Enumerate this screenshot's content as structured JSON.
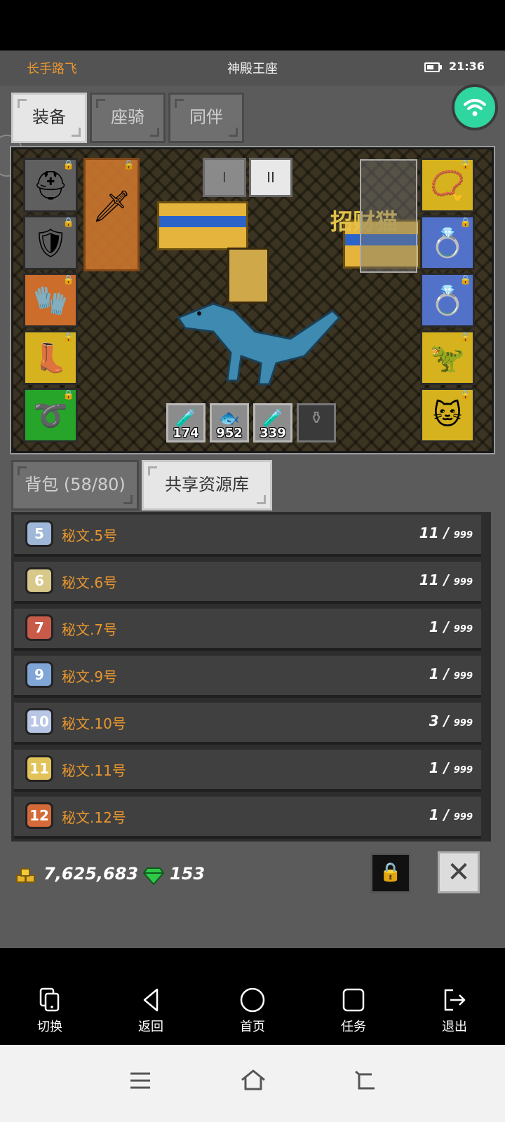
{
  "header": {
    "player_name": "长手路飞",
    "screen_title": "神殿王座",
    "time": "21:36"
  },
  "top_tabs": [
    {
      "label": "装备",
      "active": true
    },
    {
      "label": "座骑",
      "active": false
    },
    {
      "label": "同伴",
      "active": false
    }
  ],
  "scene": {
    "page_buttons": [
      "I",
      "II"
    ],
    "shop_sign": "招财猫",
    "consumables": [
      {
        "icon": "potion-icon",
        "count": "174"
      },
      {
        "icon": "fish-icon",
        "count": "952"
      },
      {
        "icon": "potion-icon",
        "count": "339"
      },
      {
        "icon": "jar-icon",
        "count": ""
      }
    ]
  },
  "inventory_tabs": [
    {
      "label": "背包 (58/80)",
      "active": false
    },
    {
      "label": "共享资源库",
      "active": true
    }
  ],
  "resources": [
    {
      "badge": "5",
      "name": "秘文.5号",
      "count": "11 /",
      "max": "999",
      "color": "#9fb7d8"
    },
    {
      "badge": "6",
      "name": "秘文.6号",
      "count": "11 /",
      "max": "999",
      "color": "#d8c98a"
    },
    {
      "badge": "7",
      "name": "秘文.7号",
      "count": "1 /",
      "max": "999",
      "color": "#c85a4a"
    },
    {
      "badge": "9",
      "name": "秘文.9号",
      "count": "1 /",
      "max": "999",
      "color": "#7fa6d6"
    },
    {
      "badge": "10",
      "name": "秘文.10号",
      "count": "3 /",
      "max": "999",
      "color": "#b8c6e6"
    },
    {
      "badge": "11",
      "name": "秘文.11号",
      "count": "1 /",
      "max": "999",
      "color": "#e2c35a"
    },
    {
      "badge": "12",
      "name": "秘文.12号",
      "count": "1 /",
      "max": "999",
      "color": "#d46a3a"
    }
  ],
  "currency": {
    "gold": "7,625,683",
    "gems": "153"
  },
  "bottom_nav": [
    {
      "label": "切换",
      "icon": "switch-icon"
    },
    {
      "label": "返回",
      "icon": "back-icon"
    },
    {
      "label": "首页",
      "icon": "home-circle-icon"
    },
    {
      "label": "任务",
      "icon": "task-square-icon"
    },
    {
      "label": "退出",
      "icon": "exit-icon"
    }
  ],
  "colors": {
    "accent_orange": "#e8962e",
    "wifi_green": "#2fd6a0"
  }
}
